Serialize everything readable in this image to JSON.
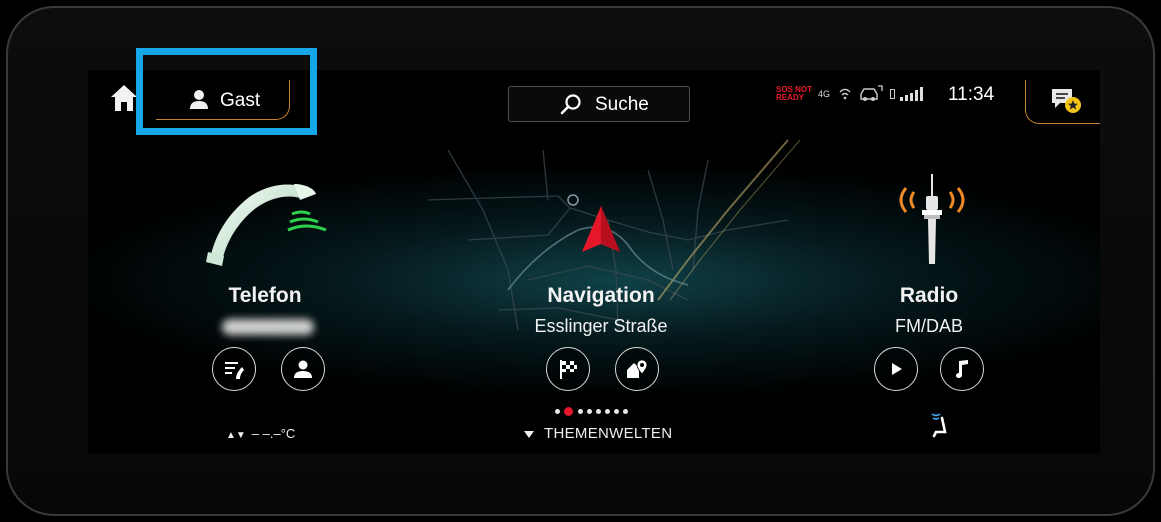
{
  "header": {
    "profile_label": "Gast",
    "search_label": "Suche",
    "status": {
      "sos_line1": "SOS NOT",
      "sos_line2": "READY",
      "network": "4G",
      "clock": "11:34"
    }
  },
  "widgets": {
    "telefon": {
      "title": "Telefon"
    },
    "navigation": {
      "title": "Navigation",
      "subtitle": "Esslinger Straße"
    },
    "radio": {
      "title": "Radio",
      "subtitle": "FM/DAB"
    }
  },
  "footer": {
    "temperature": "– –.–°C",
    "themen_label": "THEMENWELTEN",
    "page_count": 8,
    "active_page": 1
  },
  "colors": {
    "highlight": "#16a7e6",
    "accent": "#c48432",
    "nav_arrow": "#e5182b",
    "phone_green": "#2fd04c",
    "radio_orange": "#f08a24"
  },
  "icons": {
    "home": "home-icon",
    "profile": "person-icon",
    "search": "magnifier-icon",
    "notification": "message-star-icon",
    "phone": "phone-handset-icon",
    "nav": "navigation-arrow-icon",
    "radio": "radio-tower-icon"
  }
}
